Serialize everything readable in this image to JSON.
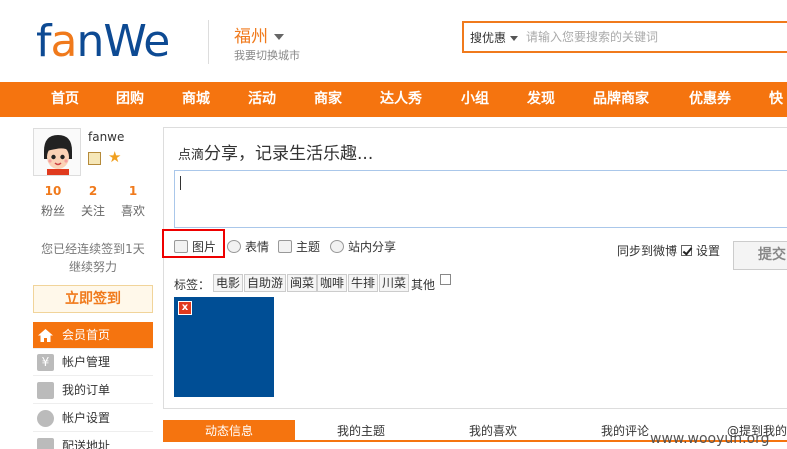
{
  "header": {
    "logo": {
      "pre": "f",
      "accent": "a",
      "post": "nWe"
    },
    "city_name": "福州",
    "city_sub": "我要切换城市",
    "search_category": "搜优惠",
    "search_placeholder": "请输入您要搜索的关键词"
  },
  "nav": [
    "首页",
    "团购",
    "商城",
    "活动",
    "商家",
    "达人秀",
    "小组",
    "发现",
    "品牌商家",
    "优惠券",
    "快"
  ],
  "user": {
    "name": "fanwe",
    "stats": [
      {
        "num": "10",
        "label": "粉丝"
      },
      {
        "num": "2",
        "label": "关注"
      },
      {
        "num": "1",
        "label": "喜欢"
      }
    ],
    "checkin_text_1": "您已经连续签到1天",
    "checkin_text_2": "继续努力",
    "checkin_button": "立即签到"
  },
  "menu": [
    "会员首页",
    "帐户管理",
    "我的订单",
    "帐户设置",
    "配送地址"
  ],
  "share": {
    "title_small": "点滴",
    "title_big": "分享，记录生活乐趣...",
    "tools": [
      "图片",
      "表情",
      "主题",
      "站内分享"
    ],
    "sync_label": "同步到微博",
    "settings_label": "设置",
    "submit_label": "提交",
    "tags_label": "标签：",
    "tags": [
      "电影",
      "自助游",
      "闽菜",
      "咖啡",
      "牛排",
      "川菜"
    ],
    "tag_other": "其他",
    "img_delete": "x"
  },
  "tabs": [
    "动态信息",
    "我的主题",
    "我的喜欢",
    "我的评论",
    "@提到我的"
  ],
  "watermark": "www.wooyun.org",
  "colors": {
    "accent": "#f5740f",
    "brand_blue": "#0d4a93"
  }
}
